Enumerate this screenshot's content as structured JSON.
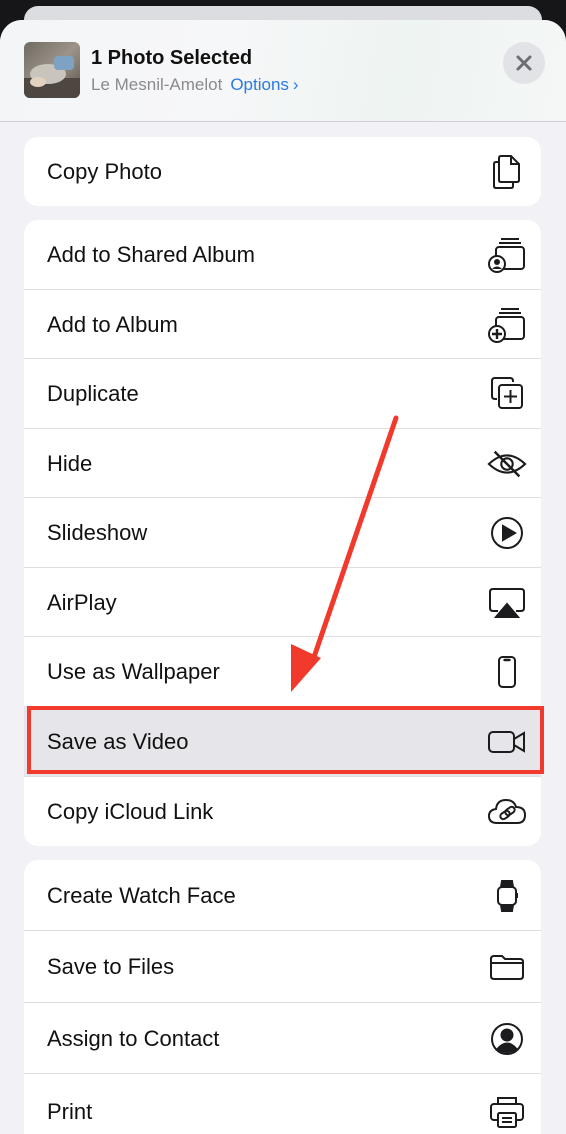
{
  "header": {
    "title": "1 Photo Selected",
    "location": "Le Mesnil-Amelot",
    "options_label": "Options",
    "options_chevron": "›"
  },
  "groups": [
    {
      "items": [
        {
          "label": "Copy Photo",
          "icon": "copy-icon"
        }
      ]
    },
    {
      "items": [
        {
          "label": "Add to Shared Album",
          "icon": "shared-album-icon"
        },
        {
          "label": "Add to Album",
          "icon": "add-album-icon"
        },
        {
          "label": "Duplicate",
          "icon": "duplicate-icon"
        },
        {
          "label": "Hide",
          "icon": "eye-slash-icon"
        },
        {
          "label": "Slideshow",
          "icon": "play-circle-icon"
        },
        {
          "label": "AirPlay",
          "icon": "airplay-icon"
        },
        {
          "label": "Use as Wallpaper",
          "icon": "phone-icon"
        },
        {
          "label": "Save as Video",
          "icon": "video-camera-icon",
          "highlighted": true
        },
        {
          "label": "Copy iCloud Link",
          "icon": "cloud-link-icon"
        }
      ]
    },
    {
      "items": [
        {
          "label": "Create Watch Face",
          "icon": "watch-icon"
        },
        {
          "label": "Save to Files",
          "icon": "folder-icon"
        },
        {
          "label": "Assign to Contact",
          "icon": "contact-icon"
        },
        {
          "label": "Print",
          "icon": "printer-icon"
        }
      ]
    }
  ],
  "colors": {
    "accent": "#2a7ae2",
    "annotation": "#f23a2c",
    "sheet_background": "#f2f2f6",
    "row_background": "#ffffff"
  }
}
